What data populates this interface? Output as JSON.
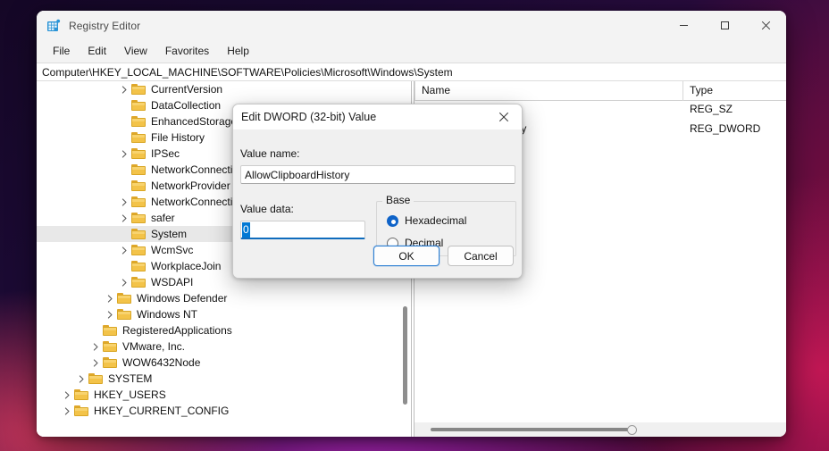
{
  "window": {
    "title": "Registry Editor",
    "icon": "registry-editor-icon",
    "controls": {
      "minimize": "Minimize",
      "maximize": "Maximize",
      "close": "Close"
    }
  },
  "menubar": {
    "items": [
      "File",
      "Edit",
      "View",
      "Favorites",
      "Help"
    ]
  },
  "address": {
    "path": "Computer\\HKEY_LOCAL_MACHINE\\SOFTWARE\\Policies\\Microsoft\\Windows\\System"
  },
  "tree": {
    "items": [
      {
        "label": "CurrentVersion",
        "indent": 5,
        "expandable": true,
        "selected": false
      },
      {
        "label": "DataCollection",
        "indent": 5,
        "expandable": false,
        "selected": false
      },
      {
        "label": "EnhancedStorageDevices",
        "indent": 5,
        "expandable": false,
        "selected": false
      },
      {
        "label": "File History",
        "indent": 5,
        "expandable": false,
        "selected": false
      },
      {
        "label": "IPSec",
        "indent": 5,
        "expandable": true,
        "selected": false
      },
      {
        "label": "NetworkConnectivity",
        "indent": 5,
        "expandable": false,
        "selected": false
      },
      {
        "label": "NetworkProvider",
        "indent": 5,
        "expandable": false,
        "selected": false
      },
      {
        "label": "NetworkConnections",
        "indent": 5,
        "expandable": true,
        "selected": false
      },
      {
        "label": "safer",
        "indent": 5,
        "expandable": true,
        "selected": false
      },
      {
        "label": "System",
        "indent": 5,
        "expandable": false,
        "selected": true
      },
      {
        "label": "WcmSvc",
        "indent": 5,
        "expandable": true,
        "selected": false
      },
      {
        "label": "WorkplaceJoin",
        "indent": 5,
        "expandable": false,
        "selected": false
      },
      {
        "label": "WSDAPI",
        "indent": 5,
        "expandable": true,
        "selected": false
      },
      {
        "label": "Windows Defender",
        "indent": 4,
        "expandable": true,
        "selected": false
      },
      {
        "label": "Windows NT",
        "indent": 4,
        "expandable": true,
        "selected": false
      },
      {
        "label": "RegisteredApplications",
        "indent": 3,
        "expandable": false,
        "selected": false
      },
      {
        "label": "VMware, Inc.",
        "indent": 3,
        "expandable": true,
        "selected": false
      },
      {
        "label": "WOW6432Node",
        "indent": 3,
        "expandable": true,
        "selected": false
      },
      {
        "label": "SYSTEM",
        "indent": 2,
        "expandable": true,
        "selected": false
      },
      {
        "label": "HKEY_USERS",
        "indent": 1,
        "expandable": true,
        "selected": false
      },
      {
        "label": "HKEY_CURRENT_CONFIG",
        "indent": 1,
        "expandable": true,
        "selected": false
      }
    ]
  },
  "list": {
    "columns": [
      "Name",
      "Type"
    ],
    "rows": [
      {
        "name": "",
        "type": "REG_SZ"
      },
      {
        "name": "AllowClipboardHistory",
        "type": "REG_DWORD"
      }
    ]
  },
  "dialog": {
    "title": "Edit DWORD (32-bit) Value",
    "close_label": "Close",
    "value_name_label": "Value name:",
    "value_name": "AllowClipboardHistory",
    "value_data_label": "Value data:",
    "value_data": "0",
    "base_legend": "Base",
    "base_options": [
      {
        "label": "Hexadecimal",
        "checked": true
      },
      {
        "label": "Decimal",
        "checked": false
      }
    ],
    "ok_label": "OK",
    "cancel_label": "Cancel"
  },
  "colors": {
    "accent": "#0078d4",
    "focus_border": "#2d7fd3",
    "folder": "#f3c349",
    "selection_row": "#e8e8e8"
  }
}
